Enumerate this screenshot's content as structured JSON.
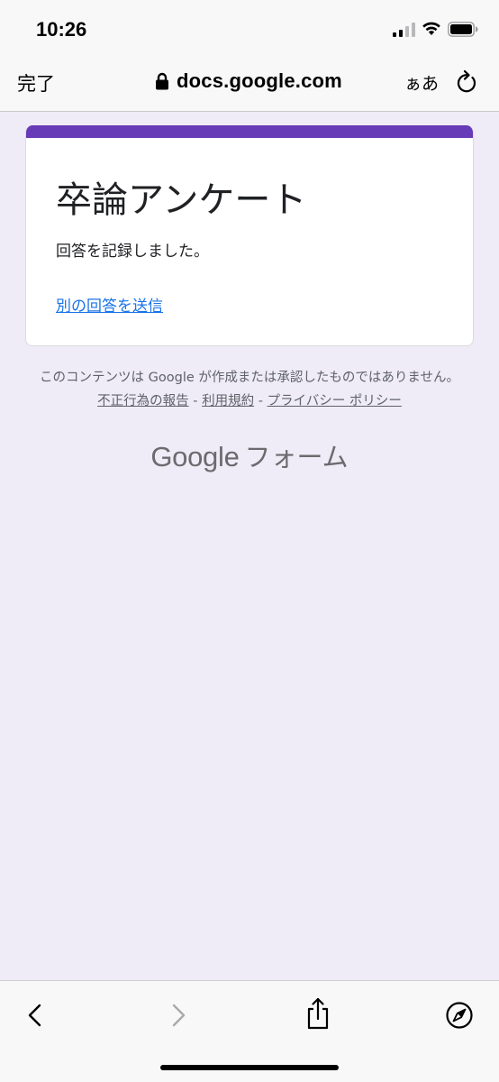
{
  "status_bar": {
    "time": "10:26",
    "signal_icon": "cellular-signal-icon",
    "wifi_icon": "wifi-icon",
    "battery_icon": "battery-icon"
  },
  "browser": {
    "done_label": "完了",
    "url": "docs.google.com",
    "text_size_label": "ぁあ",
    "lock_icon": "lock-icon",
    "reload_icon": "reload-icon"
  },
  "form": {
    "title": "卒論アンケート",
    "confirmation_message": "回答を記録しました。",
    "submit_another_link": "別の回答を送信",
    "accent_color": "#673ab7"
  },
  "footer": {
    "disclaimer_text": "このコンテンツは Google が作成または承認したものではありません。",
    "report_abuse_link": "不正行為の報告",
    "separator": "-",
    "terms_link": "利用規約",
    "privacy_link": "プライバシー ポリシー"
  },
  "branding": {
    "google_word": "Google",
    "forms_word": "フォーム"
  },
  "toolbar": {
    "back_icon": "chevron-left-icon",
    "forward_icon": "chevron-right-icon",
    "share_icon": "share-icon",
    "compass_icon": "compass-icon"
  },
  "colors": {
    "page_background": "#efebf7",
    "link": "#1a73e8"
  }
}
